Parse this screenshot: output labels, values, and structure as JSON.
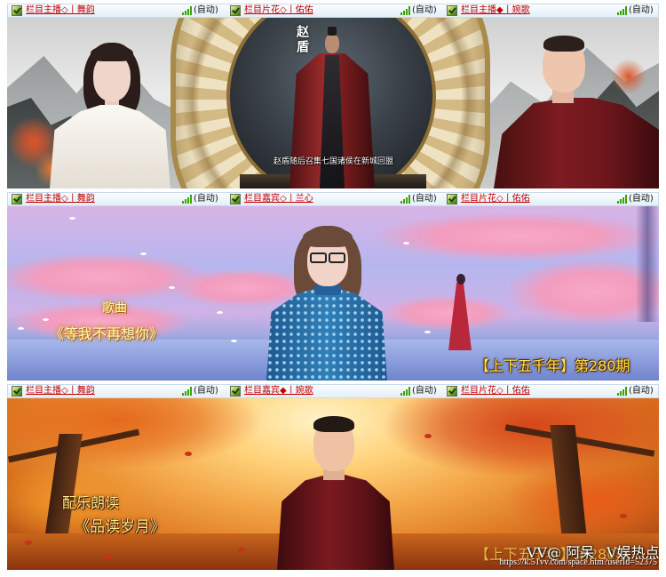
{
  "colors": {
    "header_background": "#e3eff9",
    "header_border": "#c6dbed",
    "slot_link": "#c40000",
    "signal_green": "#3aa500",
    "episode_yellow": "#ffe54d"
  },
  "panels": [
    {
      "slots": [
        {
          "icon": "vv-logo-icon",
          "label": "栏目主播◇丨舞韵",
          "signal_icon": "signal-strength-icon",
          "mode": "(自动)"
        },
        {
          "icon": "vv-logo-icon",
          "label": "栏目片花◇丨佑佑",
          "signal_icon": "signal-strength-icon",
          "mode": "(自动)"
        },
        {
          "icon": "vv-logo-icon",
          "label": "栏目主播◆丨婉歌",
          "signal_icon": "signal-strength-icon",
          "mode": "(自动)"
        }
      ],
      "video": {
        "vertical_caption": "赵盾",
        "subtitle": "赵盾随后召集七国诸侯在新城回盟"
      }
    },
    {
      "slots": [
        {
          "icon": "vv-logo-icon",
          "label": "栏目主播◇丨舞韵",
          "signal_icon": "signal-strength-icon",
          "mode": "(自动)"
        },
        {
          "icon": "vv-logo-icon",
          "label": "栏目嘉宾◇丨兰心",
          "signal_icon": "signal-strength-icon",
          "mode": "(自动)"
        },
        {
          "icon": "vv-logo-icon",
          "label": "栏目片花◇丨佑佑",
          "signal_icon": "signal-strength-icon",
          "mode": "(自动)"
        }
      ],
      "video": {
        "song_kicker": "歌曲",
        "song_title": "《等我不再想你》",
        "episode": "【上下五千年】第280期"
      }
    },
    {
      "slots": [
        {
          "icon": "vv-logo-icon",
          "label": "栏目主播◇丨舞韵",
          "signal_icon": "signal-strength-icon",
          "mode": "(自动)"
        },
        {
          "icon": "vv-logo-icon",
          "label": "栏目嘉宾◆丨婉歌",
          "signal_icon": "signal-strength-icon",
          "mode": "(自动)"
        },
        {
          "icon": "vv-logo-icon",
          "label": "栏目片花◇丨佑佑",
          "signal_icon": "signal-strength-icon",
          "mode": "(自动)"
        }
      ],
      "video": {
        "reading_kicker": "配乐朗读",
        "reading_title": "《品读岁月》",
        "episode": "【上下五千年】第280期",
        "watermark_brand": "VV@ 阿呆",
        "watermark_channel": "V娱热点",
        "watermark_url": "https://k.51vv.com/space.htm?userId=52375"
      }
    }
  ]
}
